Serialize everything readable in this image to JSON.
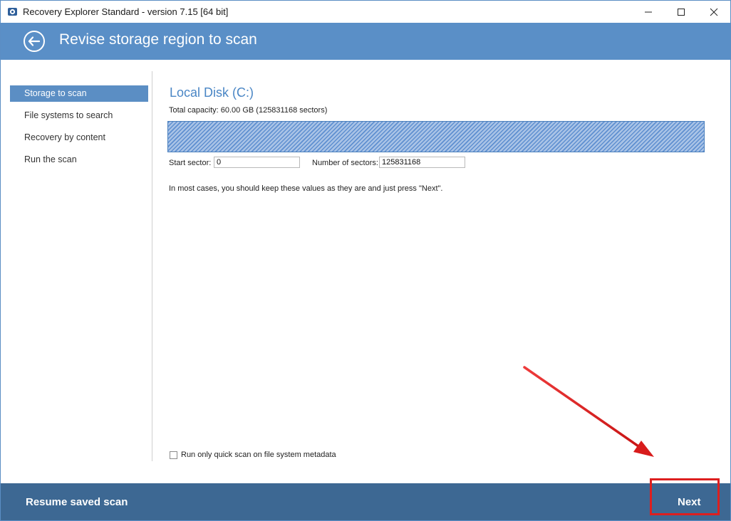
{
  "window": {
    "title": "Recovery Explorer Standard - version 7.15 [64 bit]"
  },
  "header": {
    "title": "Revise storage region to scan"
  },
  "sidebar": {
    "items": [
      {
        "label": "Storage to scan",
        "active": true
      },
      {
        "label": "File systems to search",
        "active": false
      },
      {
        "label": "Recovery by content",
        "active": false
      },
      {
        "label": "Run the scan",
        "active": false
      }
    ]
  },
  "main": {
    "disk_title": "Local Disk (C:)",
    "capacity": "Total capacity: 60.00 GB (125831168 sectors)",
    "start_sector_label": "Start sector:",
    "start_sector_value": "0",
    "num_sectors_label": "Number of sectors:",
    "num_sectors_value": "125831168",
    "hint": "In most cases, you should keep these values as they are and just press \"Next\".",
    "quick_scan_label": "Run only quick scan on file system metadata",
    "quick_scan_checked": false
  },
  "footer": {
    "resume_label": "Resume saved scan",
    "next_label": "Next"
  },
  "colors": {
    "header": "#5a8fc7",
    "footer": "#3d6893",
    "accent": "#5b8ec4",
    "annotation": "#dd1f1f"
  }
}
